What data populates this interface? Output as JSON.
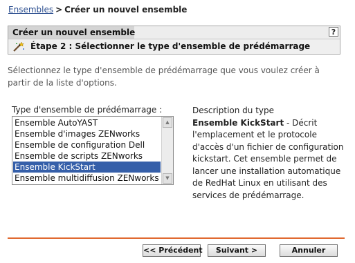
{
  "breadcrumb": {
    "link": "Ensembles",
    "separator": ">",
    "current": "Créer un nouvel ensemble"
  },
  "panel": {
    "title": "Créer un nouvel ensemble",
    "help_label": "?",
    "step": "Étape 2 : Sélectionner le type d'ensemble de prédémarrage",
    "step_icon": "wizard-wand-icon"
  },
  "intro": "Sélectionnez le type d'ensemble de prédémarrage que vous voulez créer à partir de la liste d'options.",
  "list": {
    "label": "Type d'ensemble de prédémarrage :",
    "options": [
      "Ensemble AutoYAST",
      "Ensemble d'images ZENworks",
      "Ensemble de configuration Dell",
      "Ensemble de scripts ZENworks",
      "Ensemble KickStart",
      "Ensemble multidiffusion ZENworks"
    ],
    "selected": "Ensemble KickStart"
  },
  "description": {
    "heading": "Description du type",
    "name": "Ensemble KickStart",
    "text": " - Décrit l'emplacement et le protocole d'accès d'un fichier de configuration kickstart. Cet ensemble permet de lancer une installation automatique de RedHat Linux en utilisant des services de prédémarrage."
  },
  "buttons": {
    "previous": "<< Précédent",
    "next": "Suivant >",
    "cancel": "Annuler"
  },
  "colors": {
    "accent_rule": "#e0682f",
    "selection": "#355fa9",
    "link": "#2a4d8f"
  }
}
